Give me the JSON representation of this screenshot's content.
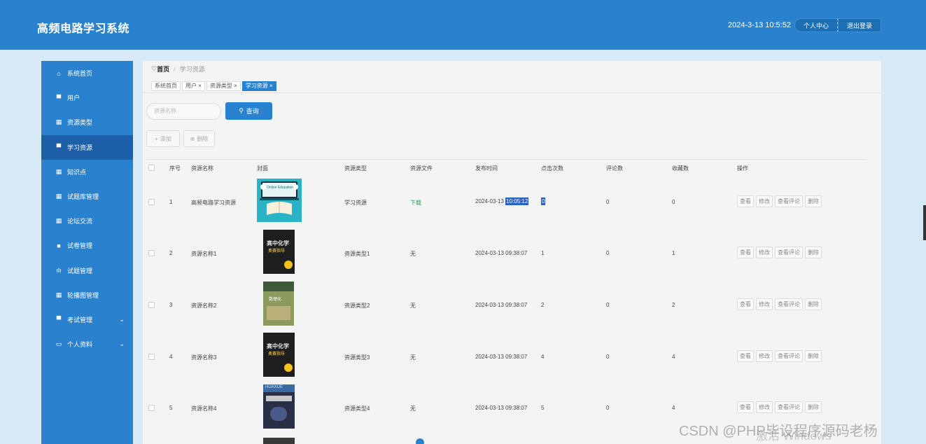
{
  "header": {
    "title": "高频电路学习系统",
    "datetime": "2024-3-13 10:5:52",
    "profile_label": "个人中心",
    "logout_label": "退出登录"
  },
  "sidebar": {
    "items": [
      {
        "label": "系统首页",
        "icon": "home-icon"
      },
      {
        "label": "用户",
        "icon": "monitor-icon"
      },
      {
        "label": "资源类型",
        "icon": "grid-icon"
      },
      {
        "label": "学习资源",
        "icon": "chat-icon"
      },
      {
        "label": "知识点",
        "icon": "grid-icon"
      },
      {
        "label": "试题库管理",
        "icon": "grid-icon"
      },
      {
        "label": "论坛交流",
        "icon": "grid-icon"
      },
      {
        "label": "试卷管理",
        "icon": "doc-icon"
      },
      {
        "label": "试题管理",
        "icon": "bar-chart-icon"
      },
      {
        "label": "轮播图管理",
        "icon": "grid-icon"
      },
      {
        "label": "考试管理",
        "icon": "monitor-icon"
      },
      {
        "label": "个人资料",
        "icon": "card-icon"
      }
    ]
  },
  "breadcrumb": {
    "home": "首页",
    "separator": "/",
    "current": "学习资源"
  },
  "tabs": [
    {
      "label": "系统首页"
    },
    {
      "label": "用户 ×"
    },
    {
      "label": "资源类型 ×"
    },
    {
      "label": "学习资源 ×"
    }
  ],
  "search": {
    "placeholder": "资源名称",
    "button_label": "查询"
  },
  "toolbar": {
    "add_label": "添加",
    "delete_label": "删除"
  },
  "table": {
    "columns": [
      "序号",
      "资源名称",
      "封面",
      "资源类型",
      "资源文件",
      "发布时间",
      "点击次数",
      "评论数",
      "收藏数",
      "操作"
    ],
    "rows": [
      {
        "index": "1",
        "name": "高频电路学习资源",
        "type": "学习资源",
        "file": "下载",
        "date": "2024-03-13",
        "time": "10:05:12",
        "clicks": "0",
        "comments": "0",
        "favorites": "0"
      },
      {
        "index": "2",
        "name": "资源名称1",
        "type": "资源类型1",
        "file": "无",
        "date": "2024-03-13",
        "time": "09:38:07",
        "clicks": "1",
        "comments": "0",
        "favorites": "1"
      },
      {
        "index": "3",
        "name": "资源名称2",
        "type": "资源类型2",
        "file": "无",
        "date": "2024-03-13",
        "time": "09:38:07",
        "clicks": "2",
        "comments": "0",
        "favorites": "2"
      },
      {
        "index": "4",
        "name": "资源名称3",
        "type": "资源类型3",
        "file": "无",
        "date": "2024-03-13",
        "time": "09:38:07",
        "clicks": "4",
        "comments": "0",
        "favorites": "4"
      },
      {
        "index": "5",
        "name": "资源名称4",
        "type": "资源类型4",
        "file": "无",
        "date": "2024-03-13",
        "time": "09:38:07",
        "clicks": "5",
        "comments": "0",
        "favorites": "4"
      }
    ],
    "actions": [
      "查看",
      "修改",
      "查看评论",
      "删除"
    ]
  },
  "covers": {
    "row1_text": "Online Education",
    "book_title": "高中化学",
    "book_sub": "奥赛指导",
    "book2_text": "数理化",
    "book5_text": "HUAXUE"
  },
  "overlays": {
    "watermark": "CSDN @PHP毕设程序源码老杨",
    "activate": "激活 Windows"
  },
  "colors": {
    "primary": "#2a82ce",
    "sidebar_active": "#1d5fa8",
    "link": "#20a060",
    "selection": "#2a5fc4"
  }
}
